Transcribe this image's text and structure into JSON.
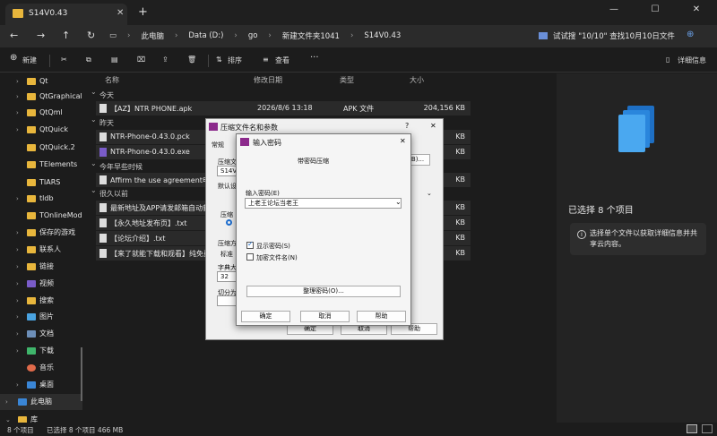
{
  "tab": {
    "title": "S14V0.43"
  },
  "nav": {
    "breadcrumbs": [
      "此电脑",
      "Data (D:)",
      "go",
      "新建文件夹1041",
      "S14V0.43"
    ],
    "search_text": "试试搜 \"10/10\" 查找10月10日文件"
  },
  "toolbar": {
    "new": "新建",
    "sort": "排序",
    "view": "查看",
    "more": "···",
    "details": "详细信息"
  },
  "sidebar": {
    "items": [
      {
        "label": "Qt"
      },
      {
        "label": "QtGraphicalE"
      },
      {
        "label": "QtQml"
      },
      {
        "label": "QtQuick"
      },
      {
        "label": "QtQuick.2"
      },
      {
        "label": "TElements"
      },
      {
        "label": "TIARS"
      },
      {
        "label": "tldb"
      },
      {
        "label": "TOnlineMode"
      },
      {
        "label": "保存的游戏"
      },
      {
        "label": "联系人"
      },
      {
        "label": "链接"
      },
      {
        "label": "视频"
      },
      {
        "label": "搜索"
      },
      {
        "label": "图片"
      },
      {
        "label": "文档"
      },
      {
        "label": "下载"
      },
      {
        "label": "音乐"
      },
      {
        "label": "桌面"
      },
      {
        "label": "此电脑"
      },
      {
        "label": "库"
      }
    ]
  },
  "columns": {
    "name": "名称",
    "date": "修改日期",
    "type": "类型",
    "size": "大小"
  },
  "groups": {
    "today": "今天",
    "yesterday": "昨天",
    "earlier_year": "今年早些时候",
    "long_ago": "很久以前"
  },
  "files": [
    {
      "name": "【AZ】NTR PHONE.apk",
      "date": "2026/8/6 13:18",
      "type": "APK 文件",
      "size": "204,156 KB"
    },
    {
      "name": "NTR-Phone-0.43.0.pck",
      "date": "",
      "type": "",
      "size": "KB"
    },
    {
      "name": "NTR-Phone-0.43.0.exe",
      "date": "",
      "type": "",
      "size": "KB"
    },
    {
      "name": "Affirm the use agreement申明使",
      "date": "",
      "type": "",
      "size": "KB"
    },
    {
      "name": "最新地址及APP请发邮箱自动获取",
      "date": "",
      "type": "",
      "size": "KB"
    },
    {
      "name": "【永久地址发布页】.txt",
      "date": "",
      "type": "",
      "size": "KB"
    },
    {
      "name": "【论坛介绍】.txt",
      "date": "",
      "type": "",
      "size": "KB"
    },
    {
      "name": "【来了就能下载和观看】纯免费",
      "date": "",
      "type": "",
      "size": "KB"
    }
  ],
  "details": {
    "selected": "已选择 8 个项目",
    "info": "选择单个文件以获取详细信息并共享云内容。"
  },
  "status": {
    "count": "8 个项目",
    "selected": "已选择 8 个项目 466 MB"
  },
  "dialog_archive": {
    "title": "压缩文件名和参数",
    "tab_general": "常规",
    "label_archive": "压缩文",
    "value_archive": "S14V0",
    "label_default": "默认设",
    "label_update": "压缩方",
    "update_value": "标准",
    "label_dict": "字典大小",
    "dict_value": "32",
    "label_split": "切分为分",
    "browse": "B)...",
    "ok": "确定",
    "cancel": "取消",
    "help": "帮助"
  },
  "dialog_password": {
    "title": "输入密码",
    "heading": "带密码压缩",
    "label_password": "输入密码(E)",
    "password_value": "上老王论坛当老王",
    "show_password": "显示密码(S)",
    "encrypt_names": "加密文件名(N)",
    "organize": "整理密码(O)...",
    "ok": "确定",
    "cancel": "取消",
    "help": "帮助"
  }
}
